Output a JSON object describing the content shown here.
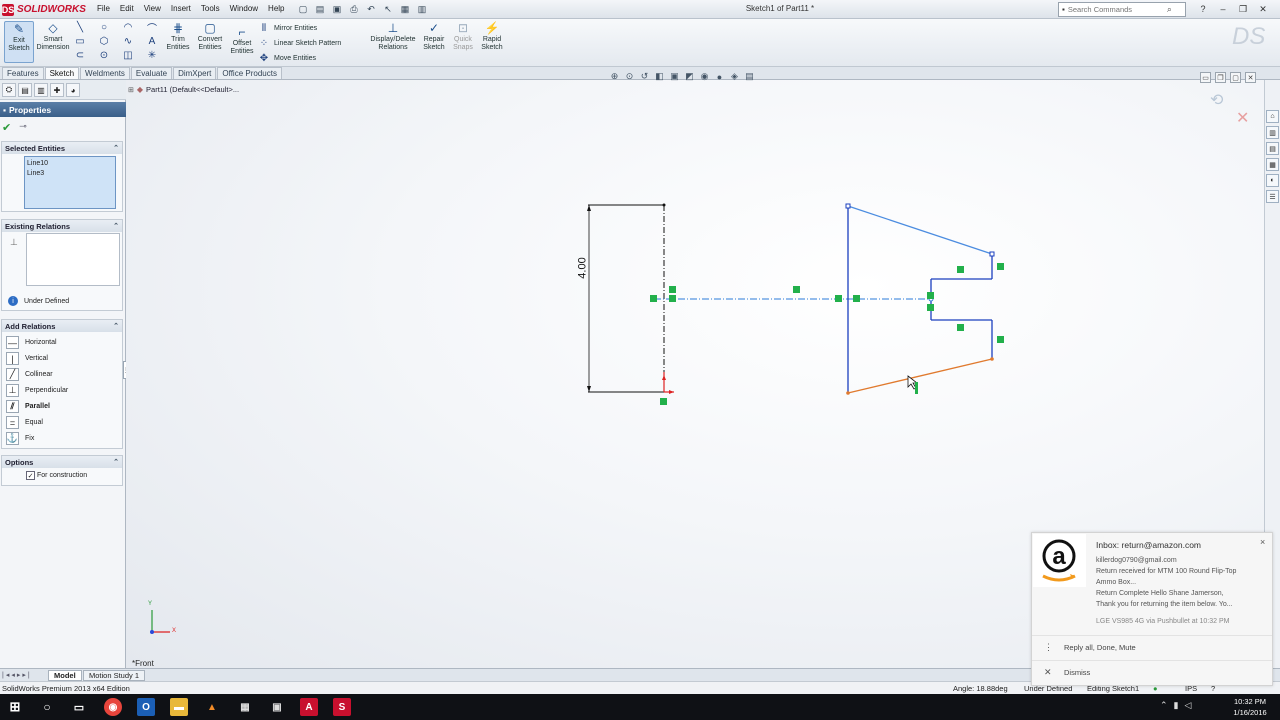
{
  "app": {
    "logo": "SOLIDWORKS",
    "logo_mark": "DS",
    "document_title": "Sketch1 of Part11 *",
    "menu": [
      "File",
      "Edit",
      "View",
      "Insert",
      "Tools",
      "Window",
      "Help"
    ],
    "search_placeholder": "Search Commands",
    "help_label": "?"
  },
  "command_manager": {
    "exit_sketch": "Exit\nSketch",
    "smart_dimension": "Smart\nDimension",
    "trim": "Trim\nEntities",
    "convert": "Convert\nEntities",
    "offset": "Offset\nEntities",
    "mirror": "Mirror Entities",
    "linear_pattern": "Linear Sketch Pattern",
    "move": "Move Entities",
    "display_relations": "Display/Delete\nRelations",
    "repair": "Repair\nSketch",
    "quick_snaps": "Quick\nSnaps",
    "rapid_sketch": "Rapid\nSketch"
  },
  "tabs": [
    "Features",
    "Sketch",
    "Weldments",
    "Evaluate",
    "DimXpert",
    "Office Products"
  ],
  "active_tab": "Sketch",
  "property_manager": {
    "title": "Properties",
    "selected_entities": {
      "header": "Selected Entities",
      "items": [
        "Line10",
        "Line3"
      ]
    },
    "existing_relations": {
      "header": "Existing Relations",
      "status": "Under Defined"
    },
    "add_relations": {
      "header": "Add Relations",
      "items": [
        "Horizontal",
        "Vertical",
        "Collinear",
        "Perpendicular",
        "Parallel",
        "Equal",
        "Fix"
      ]
    },
    "options": {
      "header": "Options",
      "for_construction": "For construction",
      "for_construction_checked": true
    }
  },
  "canvas": {
    "tree_root": "Part11  (Default<<Default>...",
    "view_label": "*Front",
    "dimension": "4.00",
    "triad_x": "X",
    "triad_y": "Y"
  },
  "bottom_tabs": [
    "Model",
    "Motion Study 1"
  ],
  "status_bar": {
    "edition": "SolidWorks Premium 2013 x64 Edition",
    "angle": "Angle: 18.88deg",
    "definition": "Under Defined",
    "editing": "Editing Sketch1",
    "units": "IPS",
    "help": "?"
  },
  "notification": {
    "title": "Inbox: return@amazon.com",
    "lines": [
      "killerdog0790@gmail.com",
      "Return received for MTM 100 Round Flip-Top",
      "Ammo Box...",
      "Return Complete Hello Shane Jamerson,",
      "Thank you for returning the item below. Yo..."
    ],
    "source": "LGE VS985 4G via Pushbullet at 10:32 PM",
    "action_reply": "Reply all, Done, Mute",
    "action_dismiss": "Dismiss",
    "close": "×"
  },
  "taskbar": {
    "time": "10:32 PM",
    "date": "1/16/2016"
  },
  "colors": {
    "accent": "#3a5f89",
    "sketch_blue": "#2b6cd4",
    "sketch_orange": "#e07a2e",
    "relation_green": "#22b04b"
  }
}
